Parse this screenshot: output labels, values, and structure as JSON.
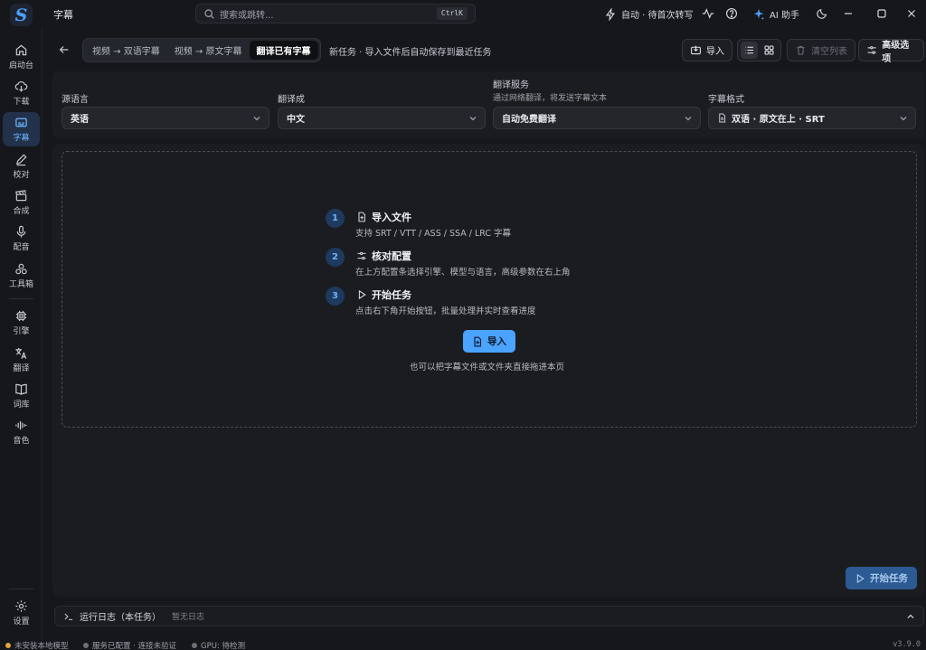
{
  "app": {
    "title": "字幕",
    "search_placeholder": "搜索或跳转...",
    "search_shortcut": "CtrlK",
    "auto_label": "自动 · 待首次转写",
    "ai_label": "AI 助手"
  },
  "sidebar": {
    "items": [
      {
        "label": "启动台",
        "icon": "home-icon"
      },
      {
        "label": "下载",
        "icon": "cloud-download-icon"
      },
      {
        "label": "字幕",
        "icon": "subtitle-icon",
        "active": true
      },
      {
        "label": "校对",
        "icon": "pen-icon"
      },
      {
        "label": "合成",
        "icon": "clapper-icon"
      },
      {
        "label": "配音",
        "icon": "microphone-icon"
      },
      {
        "label": "工具箱",
        "icon": "toolbox-icon"
      },
      {
        "label": "引擎",
        "icon": "chip-icon"
      },
      {
        "label": "翻译",
        "icon": "translate-icon"
      },
      {
        "label": "词库",
        "icon": "book-icon"
      },
      {
        "label": "音色",
        "icon": "waveform-icon"
      }
    ],
    "settings_label": "设置"
  },
  "toolbar": {
    "modes": [
      "视频 → 双语字幕",
      "视频 → 原文字幕",
      "翻译已有字幕"
    ],
    "active_mode": "翻译已有字幕",
    "hint": "新任务 · 导入文件后自动保存到最近任务",
    "import_label": "导入",
    "clear_label": "清空列表",
    "advanced_label": "高级选项"
  },
  "config": {
    "source_label": "源语言",
    "source_value": "英语",
    "target_label": "翻译成",
    "target_value": "中文",
    "service_label": "翻译服务",
    "service_sub": "通过网络翻译，将发送字幕文本",
    "service_value": "自动免费翻译",
    "format_label": "字幕格式",
    "format_value": "双语 · 原文在上 · SRT"
  },
  "steps": [
    {
      "num": "1",
      "title": "导入文件",
      "desc": "支持 SRT / VTT / ASS / SSA / LRC 字幕",
      "icon": "file-plus-icon"
    },
    {
      "num": "2",
      "title": "核对配置",
      "desc": "在上方配置条选择引擎、模型与语言，高级参数在右上角",
      "icon": "sliders-icon"
    },
    {
      "num": "3",
      "title": "开始任务",
      "desc": "点击右下角开始按钮，批量处理并实时查看进度",
      "icon": "play-icon"
    }
  ],
  "dropzone": {
    "import_label": "导入",
    "hint": "也可以把字幕文件或文件夹直接拖进本页"
  },
  "start_label": "开始任务",
  "log": {
    "title": "运行日志（本任务）",
    "empty": "暂无日志"
  },
  "status": {
    "model": "未安装本地模型",
    "service": "服务已配置 · 连接未验证",
    "gpu": "GPU: 待检测",
    "version": "v3.9.0"
  },
  "colors": {
    "accent": "#4aa3ff",
    "warning": "#e3a23b",
    "muted_dot": "#6b7079"
  }
}
